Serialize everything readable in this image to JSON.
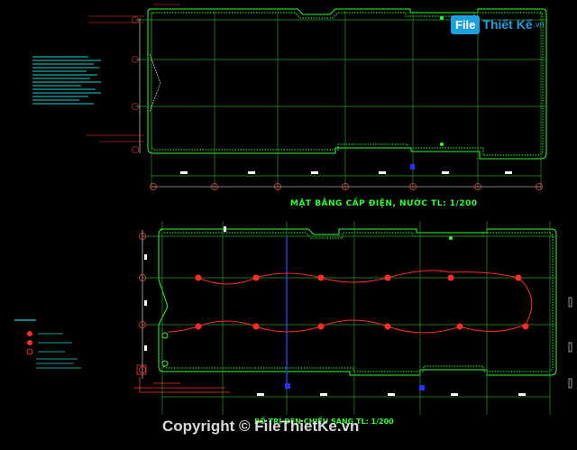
{
  "drawing": {
    "title_top": "MẶT BẰNG CẤP ĐIỆN, NƯỚC TL: 1/200",
    "title_bottom": "BỐ TRÍ ĐÈN CHIẾU SÁNG TL: 1/200"
  },
  "watermark": {
    "logo_badge": "File",
    "logo_rest": "Thiết Kế",
    "logo_suffix": ".vn",
    "copyright": "Copyright © FileThietKe.vn"
  },
  "colors": {
    "background": "#000000",
    "wall": "#2fff2f",
    "grid": "#1f9e1f",
    "dim": "#ffffff",
    "lamp": "#ff2a2a",
    "notes": "#22d3d3",
    "brand": "#1ba0e0"
  },
  "icons": [
    "grid-axis-marker-icon",
    "lamp-symbol-icon"
  ]
}
